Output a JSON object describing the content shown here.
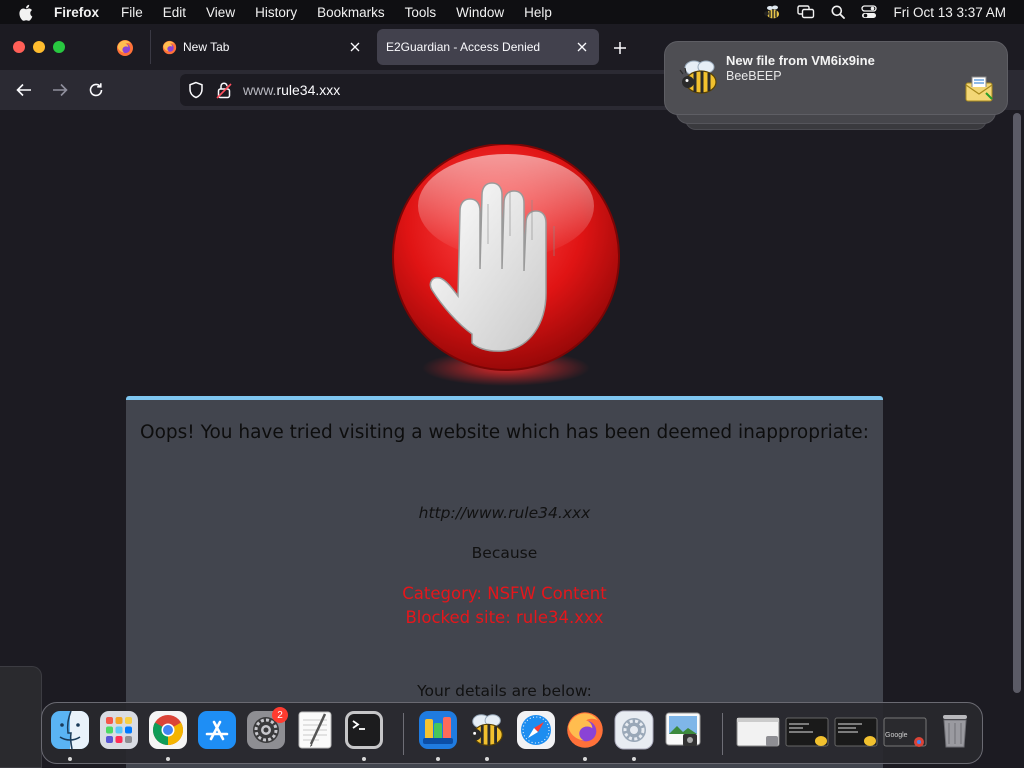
{
  "menubar": {
    "app_name": "Firefox",
    "menus": [
      "File",
      "Edit",
      "View",
      "History",
      "Bookmarks",
      "Tools",
      "Window",
      "Help"
    ],
    "clock": "Fri Oct 13  3:37 AM"
  },
  "browser": {
    "tabs": [
      {
        "title": "New Tab",
        "active": false
      },
      {
        "title": "E2Guardian - Access Denied",
        "active": true
      }
    ],
    "url": {
      "prefix": "www.",
      "host": "rule34.xxx"
    }
  },
  "page": {
    "headline": "Oops! You have tried visiting a website which has been deemed inappropriate:",
    "blocked_url": "http://www.rule34.xxx",
    "because": "Because",
    "category": "Category: NSFW Content",
    "blocked_site": "Blocked site: rule34.xxx",
    "details": "Your details are below:",
    "colors": {
      "alert_red": "#e5161b",
      "panel_accent": "#7ec6f0"
    }
  },
  "notification": {
    "title": "New file from VM6ix9ine",
    "app": "BeeBEEP",
    "icon": "bee-icon",
    "attachment_icon": "envelope-icon"
  },
  "dock": {
    "items": [
      "Finder",
      "Launchpad",
      "Google Chrome",
      "App Store",
      "System Settings",
      "TextEdit",
      "Terminal",
      "Cloud Storage",
      "BeeBEEP",
      "Safari",
      "Firefox",
      "Network Utility",
      "Preview",
      "Trash"
    ],
    "settings_badge": "2",
    "window_thumb_label": "Google"
  }
}
